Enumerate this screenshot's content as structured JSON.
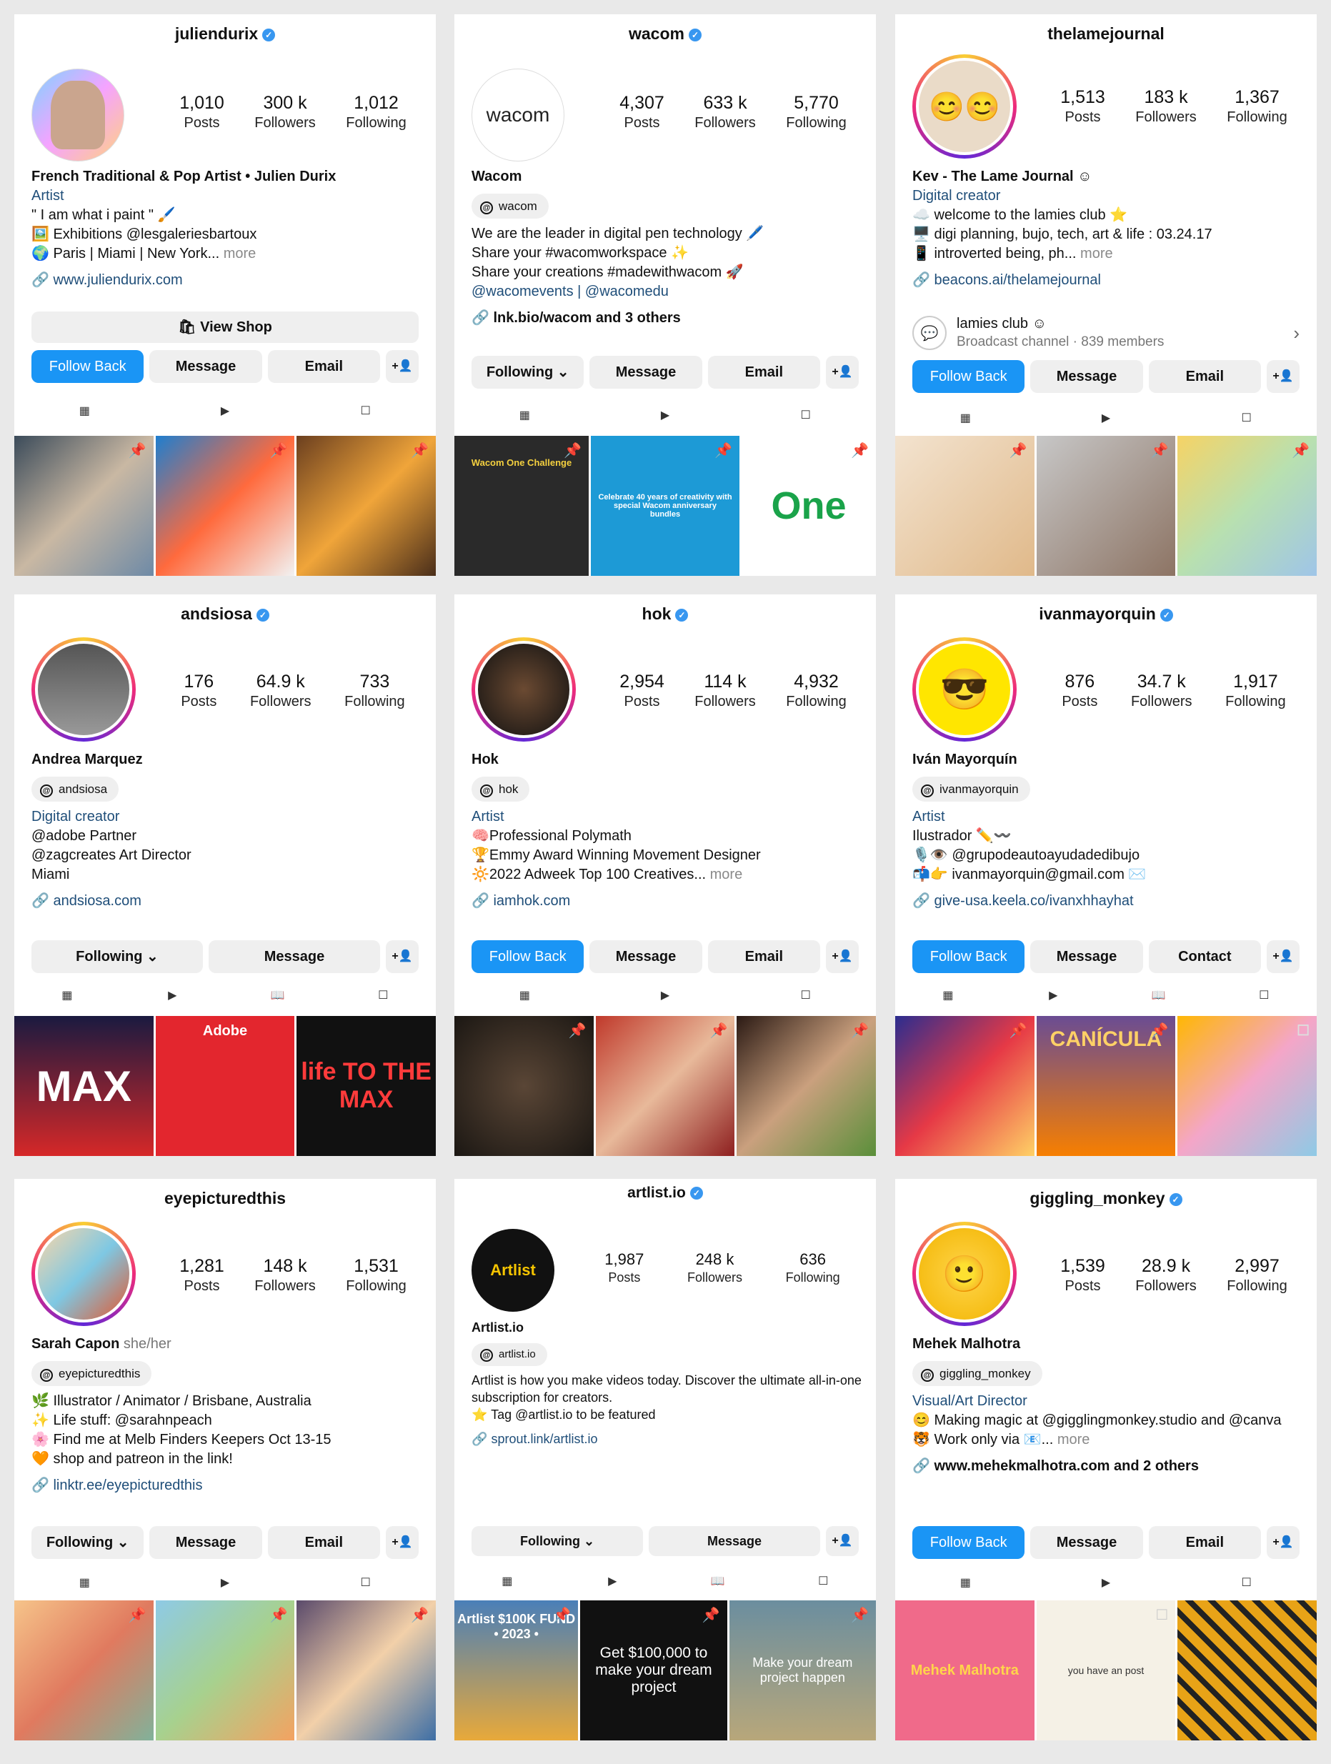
{
  "profiles": [
    {
      "handle": "juliendurix",
      "posts": "1,010",
      "followers": "300 k",
      "following": "1,012",
      "posts_label": "Posts",
      "followers_label": "Followers",
      "following_label": "Following",
      "name": "French Traditional & Pop Artist • Julien Durix",
      "category": "Artist",
      "bio": [
        "\" I am what i paint \" 🖌️",
        "🖼️ Exhibitions @lesgaleriesbartoux",
        "🌍 Paris | Miami | New York..."
      ],
      "more": "more",
      "link": "www.juliendurix.com",
      "shop": "View Shop",
      "buttons": [
        "Follow Back",
        "Message",
        "Email"
      ]
    },
    {
      "handle": "wacom",
      "avatar_text": "wacom",
      "posts": "4,307",
      "followers": "633 k",
      "following": "5,770",
      "name": "Wacom",
      "threads": "wacom",
      "bio": [
        "We are the leader in digital pen technology 🖊️",
        "Share your #wacomworkspace ✨",
        "Share your creations #madewithwacom 🚀",
        "@wacomevents | @wacomedu"
      ],
      "link": "lnk.bio/wacom and 3 others",
      "buttons": [
        "Following",
        "Message",
        "Email"
      ],
      "tiles": [
        "Wacom One Challenge",
        "Celebrate 40 years of creativity with special Wacom anniversary bundles",
        "One"
      ]
    },
    {
      "handle": "thelamejournal",
      "posts": "1,513",
      "followers": "183 k",
      "following": "1,367",
      "name": "Kev - The Lame Journal ☺",
      "category": "Digital creator",
      "bio": [
        "☁️ welcome to the lamies club ⭐",
        "🖥️ digi planning, bujo, tech, art & life : 03.24.17",
        "📱 introverted being, ph..."
      ],
      "more": "more",
      "link": "beacons.ai/thelamejournal",
      "channel_title": "lamies club ☺",
      "channel_sub": "Broadcast channel · 839 members",
      "buttons": [
        "Follow Back",
        "Message",
        "Email"
      ]
    },
    {
      "handle": "andsiosa",
      "posts": "176",
      "followers": "64.9 k",
      "following": "733",
      "name": "Andrea Marquez",
      "threads": "andsiosa",
      "category": "Digital creator",
      "bio": [
        "@adobe Partner",
        "@zagcreates Art Director",
        "Miami"
      ],
      "link": "andsiosa.com",
      "buttons": [
        "Following",
        "Message"
      ],
      "tiles": [
        "MAX",
        "Adobe",
        "life TO THE MAX"
      ]
    },
    {
      "handle": "hok",
      "posts": "2,954",
      "followers": "114 k",
      "following": "4,932",
      "name": "Hok",
      "threads": "hok",
      "category": "Artist",
      "bio": [
        "🧠Professional Polymath",
        "🏆Emmy Award Winning Movement Designer",
        "🔆2022 Adweek Top 100 Creatives..."
      ],
      "more": "more",
      "link": "iamhok.com",
      "buttons": [
        "Follow Back",
        "Message",
        "Email"
      ]
    },
    {
      "handle": "ivanmayorquin",
      "posts": "876",
      "followers": "34.7 k",
      "following": "1,917",
      "name": "Iván Mayorquín",
      "threads": "ivanmayorquin",
      "category": "Artist",
      "bio": [
        "Ilustrador ✏️〰️",
        "🎙️👁️ @grupodeautoayudadedibujo",
        "📬👉 ivanmayorquin@gmail.com ✉️"
      ],
      "link": "give-usa.keela.co/ivanxhhayhat",
      "buttons": [
        "Follow Back",
        "Message",
        "Contact"
      ],
      "tiles": [
        "",
        "CANÍCULA",
        ""
      ]
    },
    {
      "handle": "eyepicturedthis",
      "posts": "1,281",
      "followers": "148 k",
      "following": "1,531",
      "name": "Sarah Capon",
      "pronoun": "she/her",
      "threads": "eyepicturedthis",
      "bio": [
        "🌿 Illustrator / Animator / Brisbane, Australia",
        "✨ Life stuff: @sarahnpeach",
        "🌸 Find me at Melb Finders Keepers Oct 13-15",
        "🧡 shop and patreon in the link!"
      ],
      "link": "linktr.ee/eyepicturedthis",
      "buttons": [
        "Following",
        "Message",
        "Email"
      ]
    },
    {
      "handle": "artlist.io",
      "avatar_text": "Artlist",
      "posts": "1,987",
      "followers": "248 k",
      "following": "636",
      "name": "Artlist.io",
      "threads": "artlist.io",
      "bio": [
        "Artlist is how you make videos today. Discover the ultimate all-in-one subscription for creators.",
        "⭐ Tag @artlist.io to be featured"
      ],
      "link": "sprout.link/artlist.io",
      "buttons": [
        "Following",
        "Message"
      ],
      "tiles": [
        "Artlist $100K FUND • 2023 •",
        "Get $100,000 to make your dream project",
        "Make your dream project happen"
      ]
    },
    {
      "handle": "giggling_monkey",
      "posts": "1,539",
      "followers": "28.9 k",
      "following": "2,997",
      "name": "Mehek Malhotra",
      "threads": "giggling_monkey",
      "category": "Visual/Art Director",
      "bio": [
        "😊 Making magic at @gigglingmonkey.studio and @canva",
        "🐯 Work only via 📧..."
      ],
      "more": "more",
      "link": "www.mehekmalhotra.com and 2 others",
      "buttons": [
        "Follow Back",
        "Message",
        "Email"
      ],
      "tiles": [
        "Mehek Malhotra",
        "you have an post",
        ""
      ]
    }
  ],
  "colors": {
    "primary_button": "#1a95f5",
    "secondary_button": "#efefef",
    "link": "#1f4e79",
    "verified": "#3897f0"
  },
  "icons": [
    "verified-icon",
    "grid-icon",
    "reels-icon",
    "guides-icon",
    "tagged-icon",
    "add-person-icon",
    "link-icon",
    "threads-icon",
    "pin-icon"
  ]
}
